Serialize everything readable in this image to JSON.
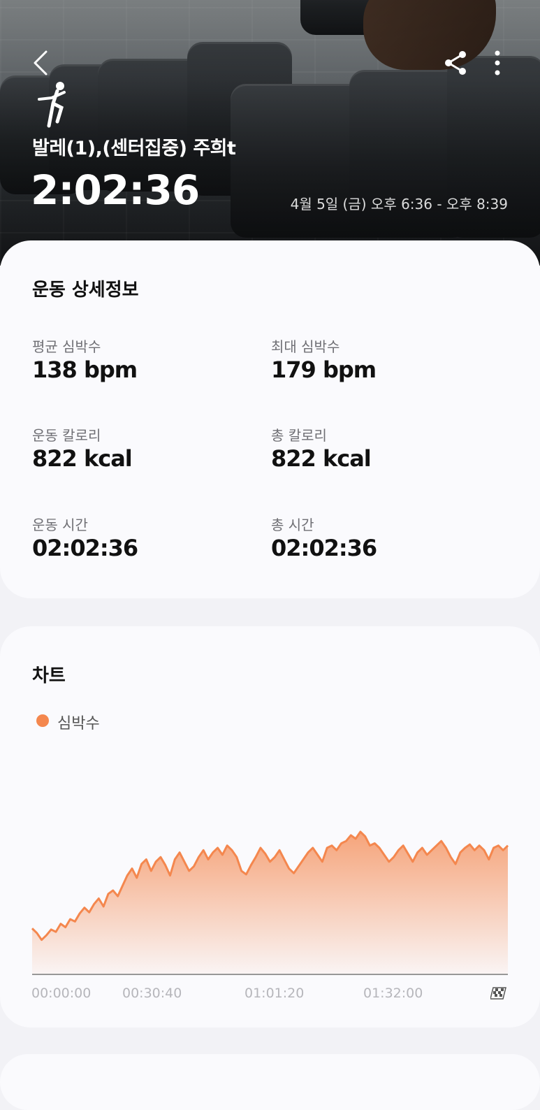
{
  "header": {
    "back_icon": "chevron-left-icon",
    "share_icon": "share-icon",
    "more_icon": "more-vertical-icon",
    "sport_icon": "ballet-dancer-icon",
    "workout_name": "발레(1),(센터집중) 주희t",
    "duration": "2:02:36",
    "date_range": "4월 5일 (금) 오후 6:36 - 오후 8:39"
  },
  "details": {
    "title": "운동 상세정보",
    "stats": [
      {
        "label": "평균 심박수",
        "value": "138 bpm"
      },
      {
        "label": "최대 심박수",
        "value": "179 bpm"
      },
      {
        "label": "운동 칼로리",
        "value": "822 kcal"
      },
      {
        "label": "총 칼로리",
        "value": "822 kcal"
      },
      {
        "label": "운동 시간",
        "value": "02:02:36"
      },
      {
        "label": "총 시간",
        "value": "02:02:36"
      }
    ]
  },
  "chart": {
    "title": "차트",
    "legend": "심박수",
    "color": "#f4874e",
    "finish_icon": "checkered-flag-icon"
  },
  "chart_data": {
    "type": "area",
    "title": "",
    "xlabel": "",
    "ylabel": "",
    "x_ticks": [
      "00:00:00",
      "00:30:40",
      "01:01:20",
      "01:32:00"
    ],
    "series": [
      {
        "name": "심박수",
        "values": [
          100,
          96,
          90,
          94,
          99,
          97,
          104,
          101,
          108,
          106,
          113,
          118,
          114,
          121,
          126,
          119,
          130,
          133,
          128,
          137,
          146,
          152,
          144,
          156,
          160,
          150,
          158,
          162,
          155,
          146,
          160,
          166,
          158,
          150,
          154,
          162,
          168,
          160,
          166,
          170,
          164,
          172,
          168,
          162,
          150,
          147,
          155,
          162,
          170,
          165,
          158,
          162,
          168,
          160,
          152,
          148,
          154,
          160,
          166,
          170,
          164,
          158,
          170,
          172,
          168,
          174,
          176,
          181,
          178,
          184,
          180,
          172,
          174,
          170,
          164,
          158,
          162,
          168,
          172,
          165,
          158,
          166,
          170,
          164,
          168,
          172,
          176,
          170,
          162,
          156,
          166,
          170,
          173,
          168,
          172,
          168,
          160,
          170,
          172,
          168,
          172
        ]
      }
    ],
    "grid": false
  }
}
